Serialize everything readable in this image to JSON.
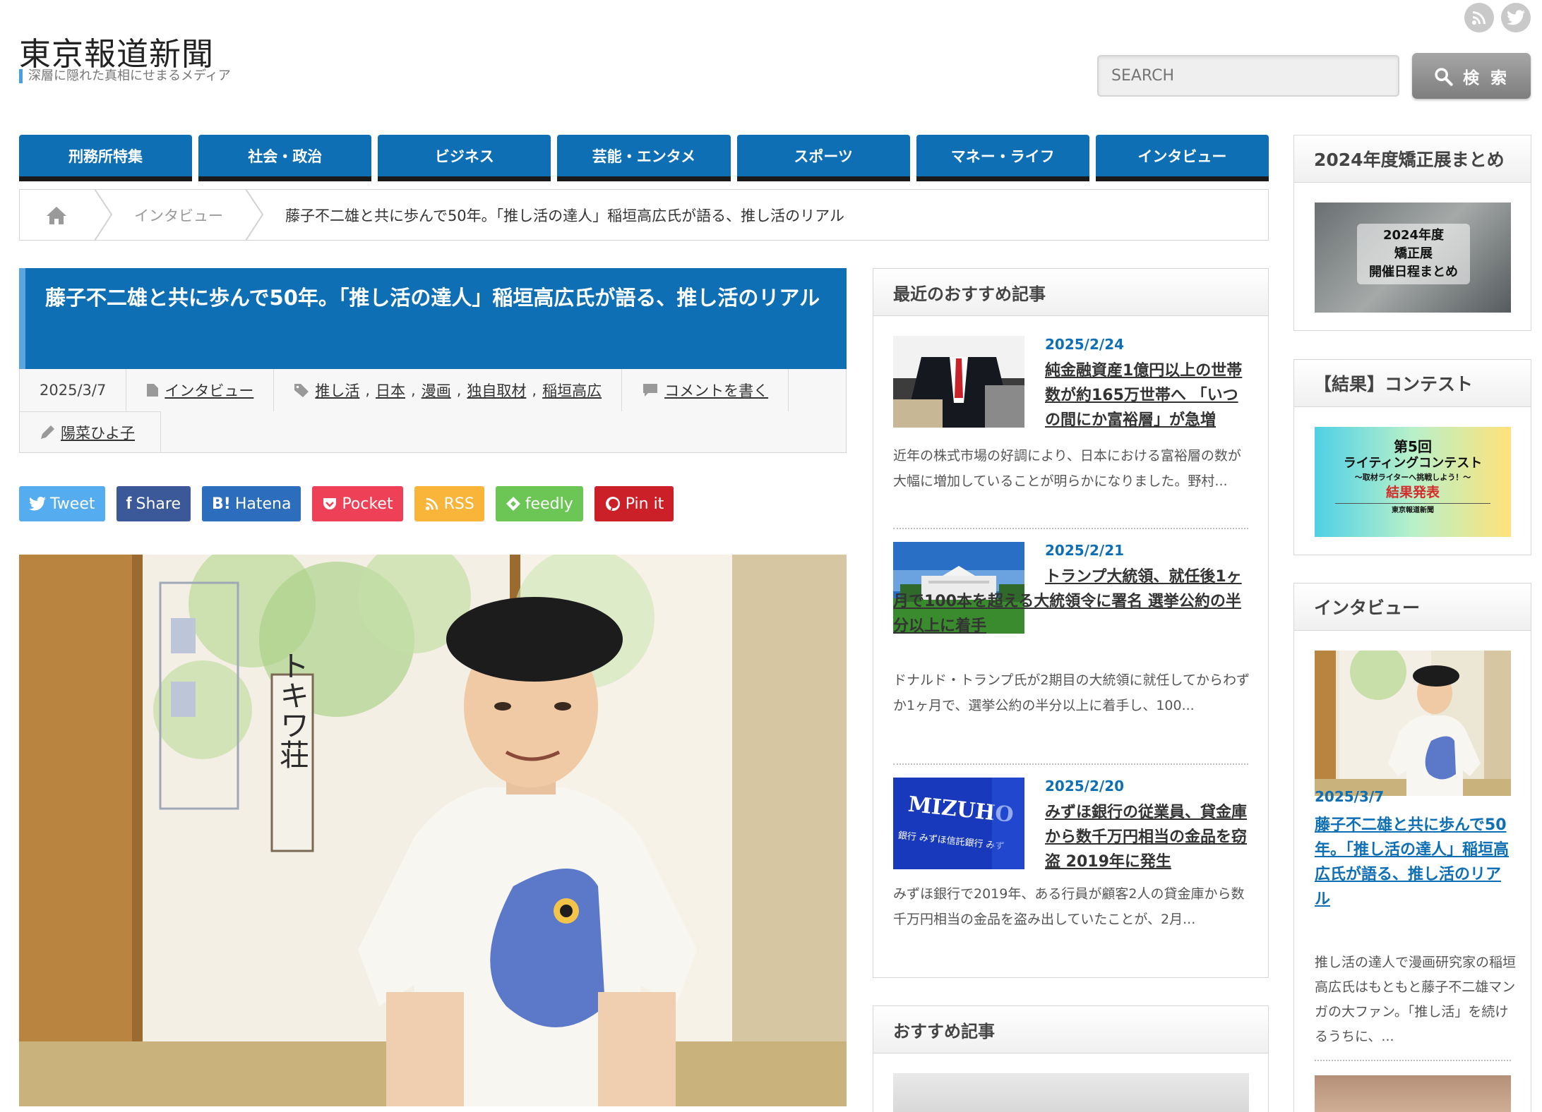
{
  "header": {
    "site_title": "東京報道新聞",
    "site_description": "深層に隠れた真相にせまるメディア",
    "search_placeholder": "SEARCH",
    "search_button": "検 索",
    "icons": [
      "rss-icon",
      "twitter-icon"
    ]
  },
  "nav": [
    "刑務所特集",
    "社会・政治",
    "ビジネス",
    "芸能・エンタメ",
    "スポーツ",
    "マネー・ライフ",
    "インタビュー"
  ],
  "breadcrumb": {
    "category": "インタビュー",
    "current": "藤子不二雄と共に歩んで50年。「推し活の達人」稲垣高広氏が語る、推し活のリアル"
  },
  "article": {
    "title": "藤子不二雄と共に歩んで50年。「推し活の達人」稲垣高広氏が語る、推し活のリアル",
    "date": "2025/3/7",
    "category": "インタビュー",
    "tags": [
      "推し活",
      "日本",
      "漫画",
      "独自取材",
      "稲垣高広"
    ],
    "comment_link": "コメントを書く",
    "author": "陽菜ひよ子"
  },
  "share": [
    {
      "label": "Tweet",
      "color": "#55acee"
    },
    {
      "label": "Share",
      "color": "#3b5998"
    },
    {
      "label": "Hatena",
      "color": "#2c6ebd"
    },
    {
      "label": "Pocket",
      "color": "#ee4056"
    },
    {
      "label": "RSS",
      "color": "#f9b43a"
    },
    {
      "label": "feedly",
      "color": "#6cc655"
    },
    {
      "label": "Pin it",
      "color": "#cb2027"
    }
  ],
  "photo_sign": "トキワ荘",
  "recent": {
    "heading": "最近のおすすめ記事",
    "items": [
      {
        "date": "2025/2/24",
        "title": "純金融資産1億円以上の世帯数が約165万世帯へ 「いつの間にか富裕層」が急増",
        "excerpt": "近年の株式市場の好調により、日本における富裕層の数が大幅に増加していることが明らかになりました。野村..."
      },
      {
        "date": "2025/2/21",
        "title": "トランプ大統領、就任後1ヶ月で100本を超える大統領令に署名 選挙公約の半分以上に着手",
        "excerpt": "ドナルド・トランプ氏が2期目の大統領に就任してからわずか1ヶ月で、選挙公約の半分以上に着手し、100..."
      },
      {
        "date": "2025/2/20",
        "title": "みずほ銀行の従業員、貸金庫から数千万円相当の金品を窃盗 2019年に発生",
        "excerpt": "みずほ銀行で2019年、ある行員が顧客2人の貸金庫から数千万円相当の金品を盗み出していたことが、2月...",
        "thumb_text": "MIZUHO",
        "thumb_subtext": "銀行 みずほ信託銀行 みず"
      }
    ]
  },
  "recommended": {
    "heading": "おすすめ記事"
  },
  "right": {
    "box1": {
      "heading": "2024年度矯正展まとめ",
      "banner": [
        "2024年度",
        "矯正展",
        "開催日程まとめ"
      ]
    },
    "box2": {
      "heading": "【結果】コンテスト",
      "banner": [
        "第5回",
        "ライティングコンテスト",
        "〜取材ライターへ挑戦しよう！〜",
        "結果発表",
        "東京報道新聞"
      ]
    },
    "box3": {
      "heading": "インタビュー",
      "date": "2025/3/7",
      "title": "藤子不二雄と共に歩んで50年。「推し活の達人」稲垣高広氏が語る、推し活のリアル",
      "excerpt": "推し活の達人で漫画研究家の稲垣高広氏はもともと藤子不二雄マンガの大ファン。「推し活」を続けるうちに、..."
    }
  },
  "colors": {
    "primary": "#0f6fb5",
    "accent": "#5aa5e0",
    "nav_border": "#1a1a1a"
  }
}
